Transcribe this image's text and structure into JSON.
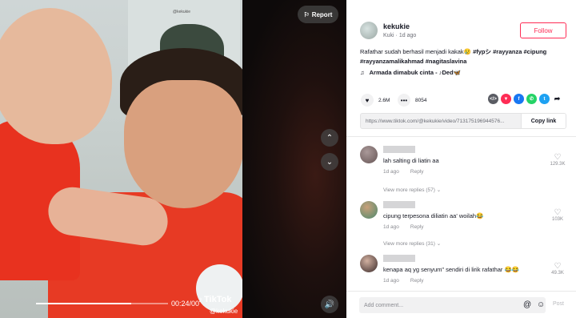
{
  "video": {
    "report_label": "Report",
    "time": "00:24/00",
    "watermark_brand": "TikTok",
    "watermark_user": "@kekukie",
    "watermark_top": "@kekukie",
    "progress_percent": 72
  },
  "author": {
    "username": "kekukie",
    "subline": "Kuki · 1d ago",
    "follow_label": "Follow"
  },
  "caption": {
    "text": "Rafathar sudah berhasil menjadi kakak😢",
    "tags": [
      "#fypシ",
      "#rayyanza",
      "#cipung",
      "#rayyanzamalikahmad",
      "#nagitaslavina"
    ]
  },
  "music": {
    "title": "Armada dimabuk cinta - ♪Ded🦋"
  },
  "stats": {
    "likes": "2.6M",
    "comments": "8054"
  },
  "share": {
    "icons": [
      "embed-icon",
      "send-icon",
      "facebook-icon",
      "whatsapp-icon",
      "twitter-icon",
      "share-arrow-icon"
    ]
  },
  "link": {
    "url": "https://www.tiktok.com/@kekukie/video/713175196944576...",
    "copy_label": "Copy link"
  },
  "comments": [
    {
      "text": "lah salting di liatin aa",
      "date": "1d ago",
      "reply_label": "Reply",
      "likes": "129.3K"
    },
    {
      "text": "cipung terpesona diliatin aa' woilah😂",
      "date": "1d ago",
      "reply_label": "Reply",
      "likes": "103K"
    },
    {
      "text": "kenapa aq yg senyum\" sendiri di lirik rafathar 😂😂",
      "date": "1d ago",
      "reply_label": "Reply",
      "likes": "49.3K"
    }
  ],
  "replies": [
    {
      "label": "View more replies (57)"
    },
    {
      "label": "View more replies (31)"
    }
  ],
  "composer": {
    "placeholder": "Add comment...",
    "post_label": "Post"
  }
}
